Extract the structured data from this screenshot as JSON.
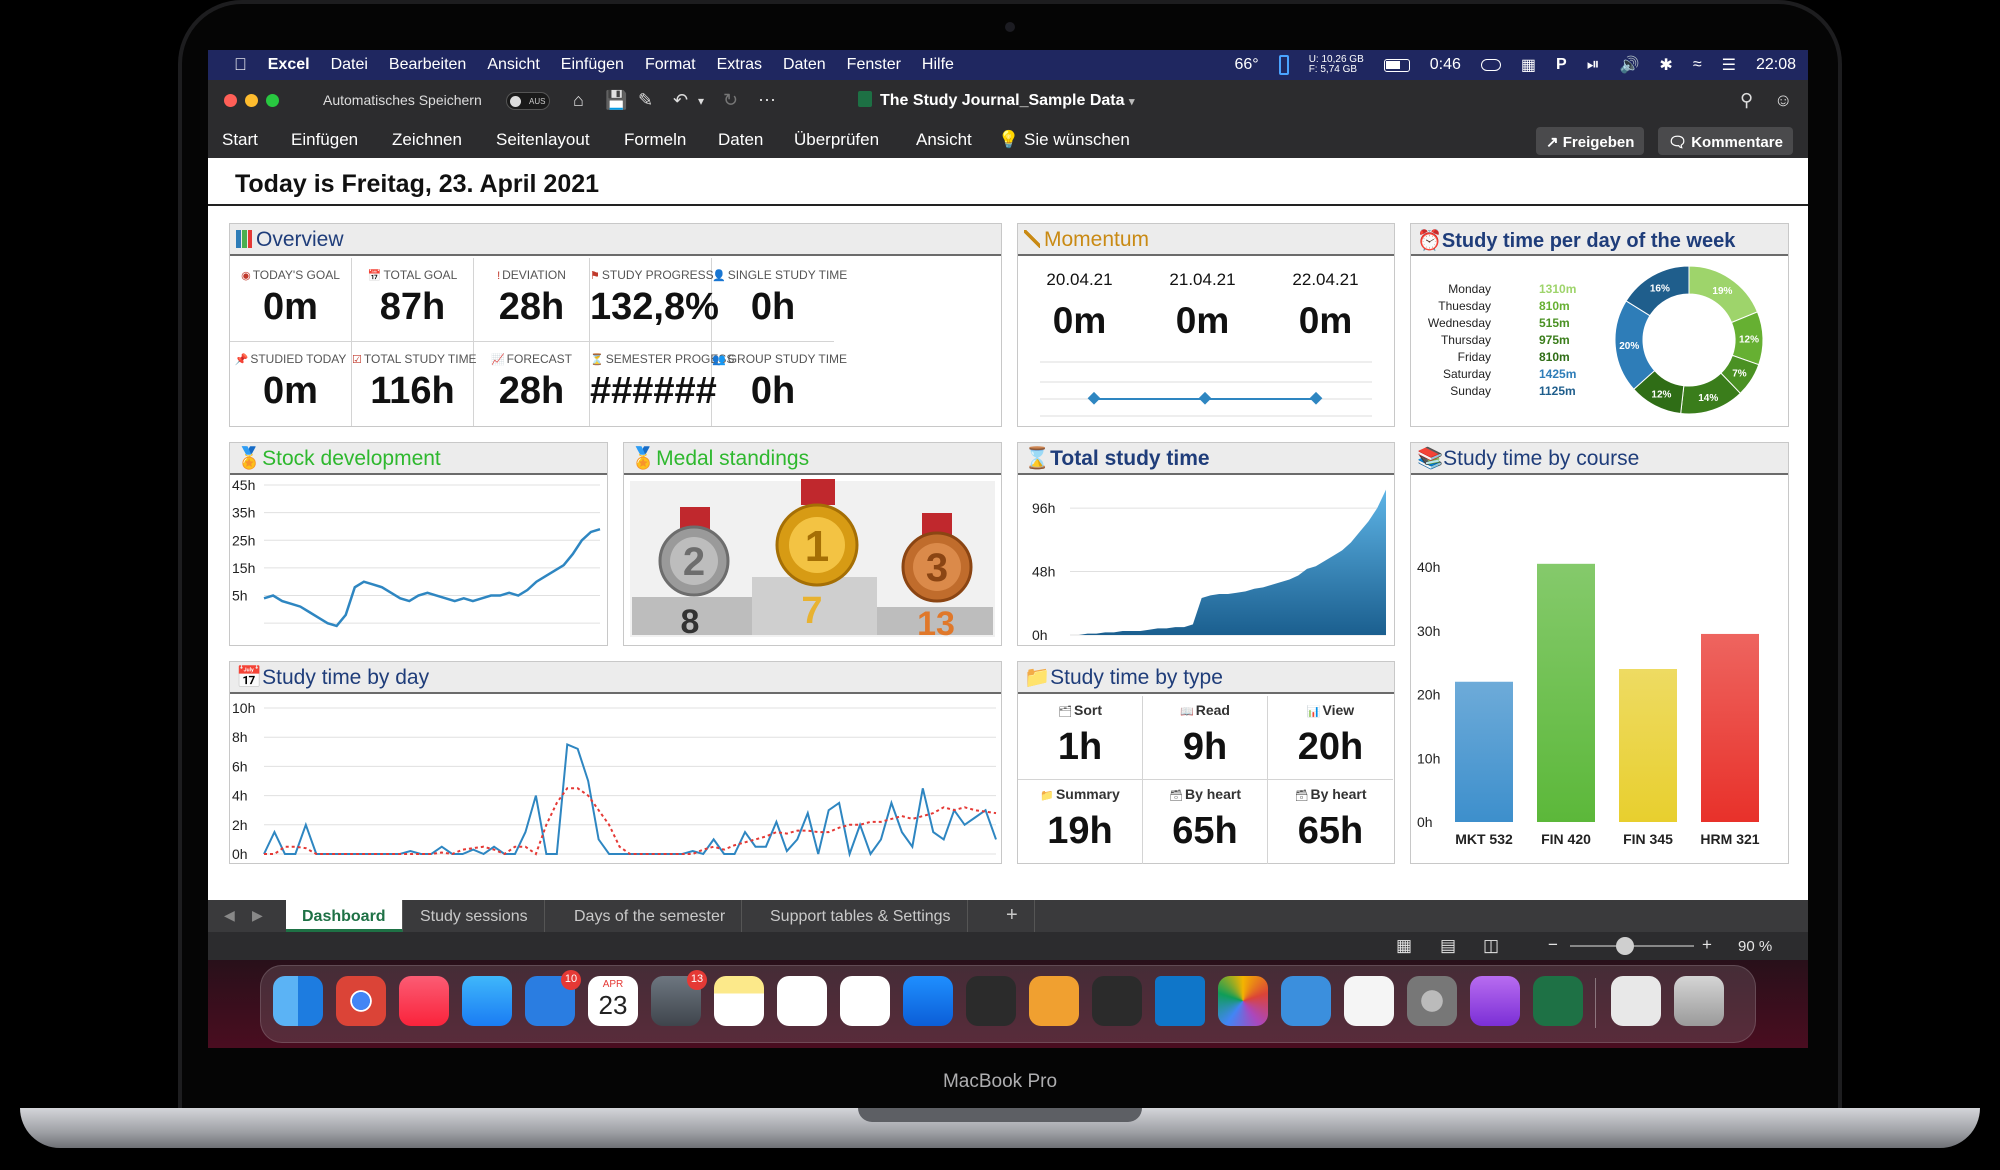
{
  "menubar": {
    "apple": "",
    "app": "Excel",
    "items": [
      "Datei",
      "Bearbeiten",
      "Ansicht",
      "Einfügen",
      "Format",
      "Extras",
      "Daten",
      "Fenster",
      "Hilfe"
    ],
    "temperature": "66°",
    "disk_u": "10,26 GB",
    "disk_f": "5,74 GB",
    "disk_u_label": "U:",
    "disk_f_label": "F:",
    "battery_time": "0:46",
    "clock": "22:08"
  },
  "titlebar": {
    "autosave": "Automatisches Speichern",
    "toggle": "AUS",
    "title": "The Study Journal_Sample Data"
  },
  "ribbon": {
    "items": [
      "Start",
      "Einfügen",
      "Zeichnen",
      "Seitenlayout",
      "Formeln",
      "Daten",
      "Überprüfen",
      "Ansicht"
    ],
    "tell_me": "Sie wünschen",
    "share": "Freigeben",
    "comments": "Kommentare"
  },
  "today": "Today is Freitag, 23. April 2021",
  "overview": {
    "title": "Overview",
    "kpis": [
      {
        "label": "TODAY'S GOAL",
        "value": "0m"
      },
      {
        "label": "TOTAL GOAL",
        "value": "87h"
      },
      {
        "label": "DEVIATION",
        "value": "28h"
      },
      {
        "label": "STUDY PROGRESS",
        "value": "132,8%"
      },
      {
        "label": "SINGLE STUDY TIME",
        "value": "0h"
      },
      {
        "label": "STUDIED TODAY",
        "value": "0m"
      },
      {
        "label": "TOTAL STUDY TIME",
        "value": "116h"
      },
      {
        "label": "FORECAST",
        "value": "28h"
      },
      {
        "label": "SEMESTER PROGESS",
        "value": "######"
      },
      {
        "label": "GROUP STUDY TIME",
        "value": "0h"
      }
    ]
  },
  "momentum": {
    "title": "Momentum",
    "days": [
      {
        "date": "20.04.21",
        "value": "0m"
      },
      {
        "date": "21.04.21",
        "value": "0m"
      },
      {
        "date": "22.04.21",
        "value": "0m"
      }
    ]
  },
  "weekday": {
    "title": "Study time per day of the week",
    "rows": [
      {
        "day": "Monday",
        "value": "1310m",
        "color": "#9ed46b"
      },
      {
        "day": "Thuesday",
        "value": "810m",
        "color": "#66b032"
      },
      {
        "day": "Wednesday",
        "value": "515m",
        "color": "#4a9123"
      },
      {
        "day": "Thursday",
        "value": "975m",
        "color": "#3a7d1b"
      },
      {
        "day": "Friday",
        "value": "810m",
        "color": "#2f6d16"
      },
      {
        "day": "Saturday",
        "value": "1425m",
        "color": "#2e7db8"
      },
      {
        "day": "Sunday",
        "value": "1125m",
        "color": "#1f5e8c"
      }
    ],
    "donut_labels": [
      "19%",
      "12%",
      "7%",
      "14%",
      "12%",
      "20%",
      "16%"
    ]
  },
  "stock": {
    "title": "Stock development",
    "yticks": [
      "45h",
      "35h",
      "25h",
      "15h",
      "5h"
    ]
  },
  "medals": {
    "title": "Medal standings",
    "silver": "8",
    "gold": "7",
    "bronze": "13",
    "silver_num": "2",
    "gold_num": "1",
    "bronze_num": "3"
  },
  "total": {
    "title": "Total study time",
    "yticks": [
      "96h",
      "48h",
      "0h"
    ]
  },
  "course": {
    "title": "Study time by course",
    "yticks": [
      "40h",
      "30h",
      "20h",
      "10h",
      "0h"
    ]
  },
  "byday": {
    "title": "Study time by day",
    "yticks": [
      "10h",
      "8h",
      "6h",
      "4h",
      "2h",
      "0h"
    ]
  },
  "bytype": {
    "title": "Study time by type",
    "items": [
      {
        "label": "Sort",
        "value": "1h"
      },
      {
        "label": "Read",
        "value": "9h"
      },
      {
        "label": "View",
        "value": "20h"
      },
      {
        "label": "Summary",
        "value": "19h"
      },
      {
        "label": "By heart",
        "value": "65h"
      },
      {
        "label": "By heart",
        "value": "65h"
      }
    ]
  },
  "tabs": [
    "Dashboard",
    "Study sessions",
    "Days of the semester",
    "Support tables & Settings"
  ],
  "tab_add": "+",
  "zoom": "90 %",
  "dock": {
    "calendar_month": "APR",
    "calendar_day": "23",
    "badge_tasks": "10",
    "badge_weather": "13"
  },
  "brand": "MacBook Pro",
  "chart_data": [
    {
      "type": "bar",
      "title": "Study time by course",
      "categories": [
        "MKT 532",
        "FIN 420",
        "FIN 345",
        "HRM 321"
      ],
      "values": [
        22,
        40.5,
        24,
        29.5
      ],
      "ylim": [
        0,
        40
      ],
      "colors": [
        "#3d8fcc",
        "#5cb83a",
        "#e8cf2e",
        "#e8312a"
      ]
    },
    {
      "type": "pie",
      "title": "Study time per day of the week",
      "categories": [
        "Monday",
        "Thuesday",
        "Wednesday",
        "Thursday",
        "Friday",
        "Saturday",
        "Sunday"
      ],
      "values": [
        1310,
        810,
        515,
        975,
        810,
        1425,
        1125
      ]
    },
    {
      "type": "area",
      "title": "Total study time",
      "values": [
        0,
        0,
        1,
        1,
        2,
        2,
        3,
        3,
        3,
        4,
        5,
        5,
        6,
        6,
        8,
        28,
        30,
        31,
        31,
        32,
        33,
        35,
        36,
        38,
        40,
        42,
        45,
        50,
        52,
        56,
        60,
        64,
        70,
        78,
        86,
        96,
        110
      ],
      "ylim": [
        0,
        115
      ]
    },
    {
      "type": "line",
      "title": "Stock development",
      "values": [
        4,
        5,
        3,
        2,
        1,
        -1,
        -3,
        -5,
        -6,
        -2,
        8,
        10,
        9,
        8,
        6,
        4,
        3,
        5,
        6,
        5,
        4,
        3,
        4,
        3,
        4,
        5,
        5,
        6,
        5,
        7,
        10,
        12,
        14,
        16,
        20,
        25,
        28,
        29
      ],
      "ylim": [
        -10,
        45
      ]
    },
    {
      "type": "line",
      "title": "Study time by day",
      "series": [
        {
          "values": [
            0,
            1.5,
            0,
            0,
            2,
            0,
            0,
            0,
            0,
            0,
            0,
            0,
            0,
            0,
            0.2,
            0,
            0,
            0.5,
            0,
            0,
            0.3,
            0,
            0.5,
            0,
            0,
            1.5,
            4,
            0,
            0,
            7.5,
            7.2,
            5,
            1,
            0,
            0,
            0,
            0,
            0,
            0,
            0,
            0,
            0.2,
            0,
            1,
            0,
            0,
            1.5,
            0.5,
            0.5,
            2.2,
            0.2,
            1,
            2.8,
            0,
            3,
            3.5,
            0,
            2,
            0,
            1,
            3.5,
            1.5,
            0.5,
            4.5,
            1.5,
            1,
            3,
            2,
            2.5,
            3,
            1
          ]
        },
        {
          "values": [
            0,
            0,
            0.5,
            0.5,
            0.4,
            0,
            0,
            0,
            0,
            0,
            0,
            0,
            0,
            0,
            0,
            0,
            0,
            0.1,
            0,
            0.3,
            0.4,
            0.5,
            0.3,
            0,
            0.5,
            0.5,
            0,
            2,
            3.5,
            4.5,
            4.5,
            4,
            3,
            2,
            0.5,
            0,
            0,
            0,
            0,
            0,
            0,
            0,
            0.3,
            0.5,
            0.3,
            0.6,
            0.8,
            1,
            1.2,
            1.5,
            1.4,
            1.6,
            1.6,
            1.5,
            1.5,
            1.8,
            2,
            2,
            2.2,
            2.2,
            2.4,
            2.6,
            2.4,
            2.6,
            2.8,
            3.2,
            3,
            3.2,
            3,
            2.9,
            2.8
          ]
        }
      ],
      "ylim": [
        0,
        10
      ]
    }
  ]
}
